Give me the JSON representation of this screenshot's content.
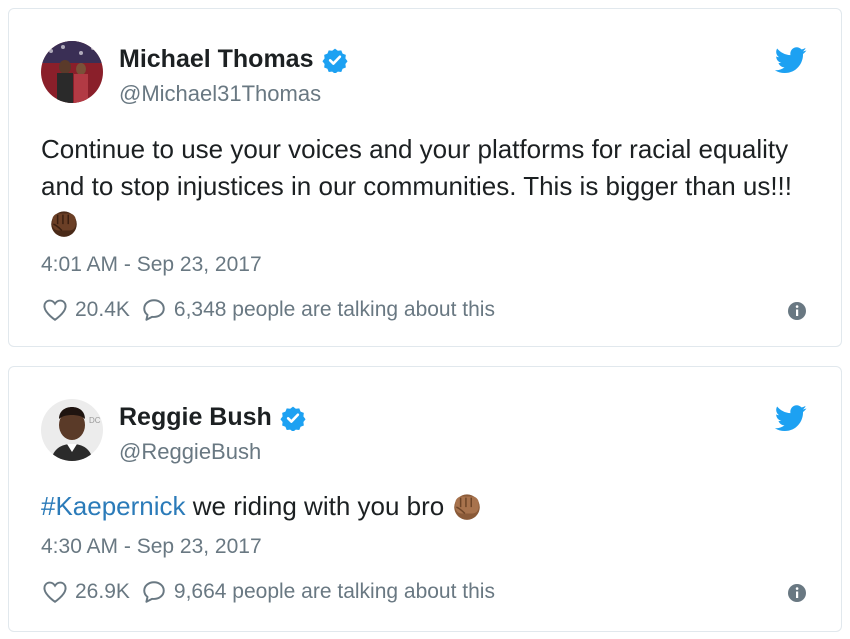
{
  "tweets": [
    {
      "name": "Michael Thomas",
      "handle": "@Michael31Thomas",
      "text": "Continue to use your voices and your platforms for racial equality and to stop injustices in our communities. This is bigger than us!!!",
      "timestamp": "4:01 AM - Sep 23, 2017",
      "likes": "20.4K",
      "talking": "6,348 people are talking about this",
      "fist_color": "#6b3f26"
    },
    {
      "name": "Reggie Bush",
      "handle": "@ReggieBush",
      "hashtag": "#Kaepernick",
      "text": " we riding with you bro",
      "timestamp": "4:30 AM - Sep 23, 2017",
      "likes": "26.9K",
      "talking": "9,664 people are talking about this",
      "fist_color": "#a8734d"
    }
  ],
  "colors": {
    "twitter_blue": "#1da1f2",
    "link": "#2b7bb9",
    "muted": "#697882",
    "border": "#e1e8ed"
  },
  "icons": {
    "verified": "verified-badge-icon",
    "brand": "twitter-bird-icon",
    "like": "heart-icon",
    "reply": "speech-bubble-icon",
    "info": "info-icon",
    "emoji": "raised-fist-icon"
  }
}
